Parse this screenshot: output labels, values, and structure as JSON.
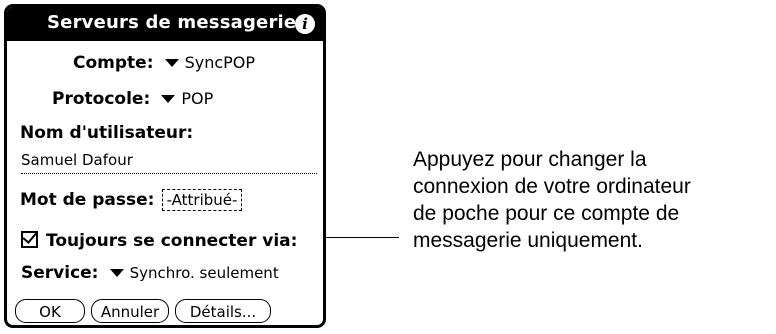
{
  "dialog": {
    "title": "Serveurs de messagerie",
    "info_icon": "info-icon",
    "account_label": "Compte:",
    "account_value": "SyncPOP",
    "protocol_label": "Protocole:",
    "protocol_value": "POP",
    "username_label": "Nom d'utilisateur:",
    "username_value": "Samuel Dafour",
    "password_label": "Mot de passe:",
    "password_value": "-Attribué-",
    "connect_via_label": "Toujours se connecter via:",
    "connect_via_checked": true,
    "service_label": "Service:",
    "service_value": "Synchro. seulement",
    "buttons": {
      "ok": "OK",
      "cancel": "Annuler",
      "details": "Détails..."
    }
  },
  "callout": {
    "lines": [
      "Appuyez pour changer la",
      "connexion de votre ordinateur",
      "de poche pour ce compte de",
      "messagerie uniquement."
    ]
  }
}
